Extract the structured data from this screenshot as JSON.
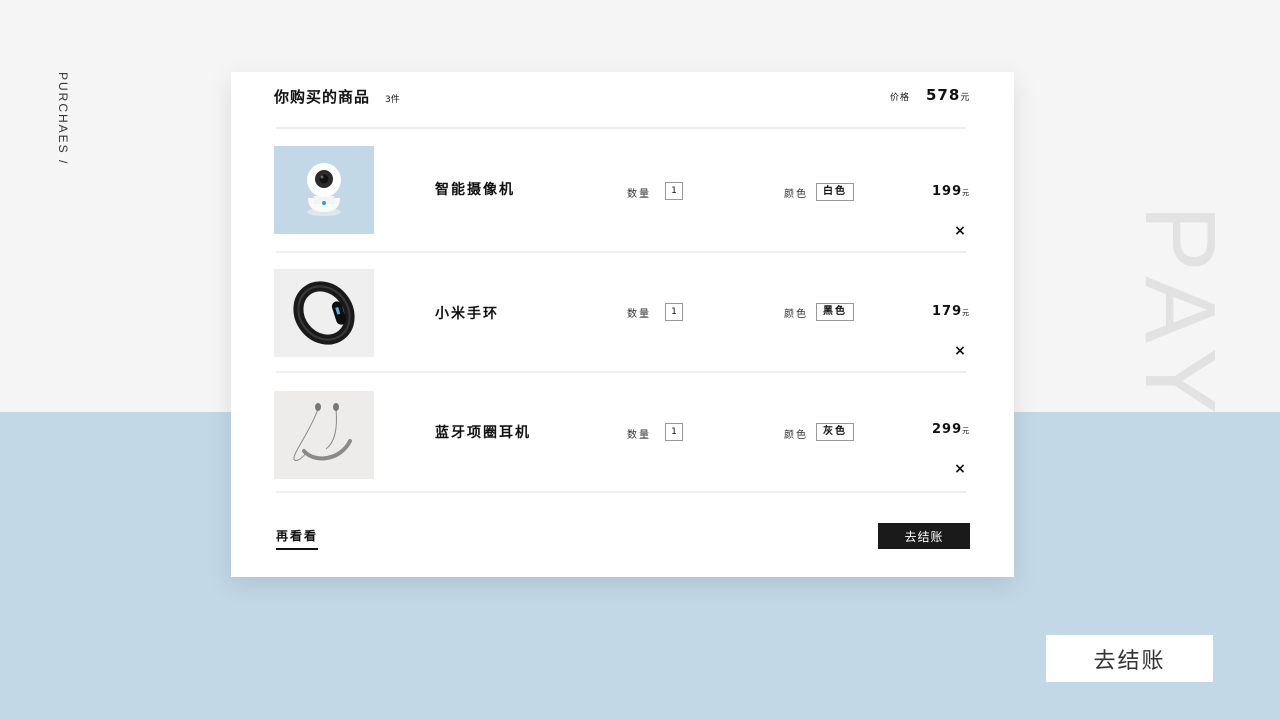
{
  "side_label": "PURCHAES /",
  "background_word": "PAY",
  "cart": {
    "title": "你购买的商品",
    "count": "3件",
    "total_label": "价格",
    "total_value": "578",
    "total_unit": "元",
    "qty_label": "数量",
    "color_label": "颜色",
    "items": [
      {
        "name": "智能摄像机",
        "qty": "1",
        "color": "白色",
        "price": "199",
        "unit": "元"
      },
      {
        "name": "小米手环",
        "qty": "1",
        "color": "黑色",
        "price": "179",
        "unit": "元"
      },
      {
        "name": "蓝牙项圈耳机",
        "qty": "1",
        "color": "灰色",
        "price": "299",
        "unit": "元"
      }
    ],
    "remove_symbol": "×",
    "back_label": "再看看",
    "checkout_label": "去结账"
  },
  "checkout_big_label": "去结账",
  "colors": {
    "top_background": "#f5f5f5",
    "bottom_background": "#c2d8e6",
    "button_dark": "#1a1a1a",
    "camera_thumb_bg": "#c2d8e6",
    "band_thumb_bg": "#efefef",
    "earphone_thumb_bg": "#eeebeb"
  },
  "icons": {
    "item_0": "smart-camera-image",
    "item_1": "fitness-band-image",
    "item_2": "neckband-earphones-image",
    "remove": "close-icon"
  }
}
